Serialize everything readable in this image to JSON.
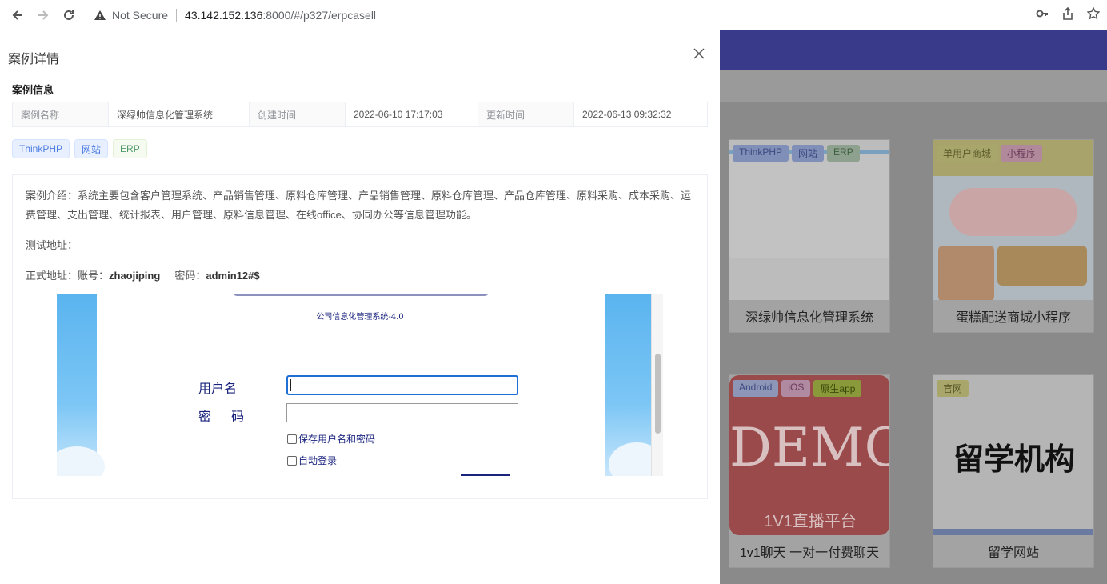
{
  "browser": {
    "not_secure": "Not Secure",
    "url_host": "43.142.152.136",
    "url_rest": ":8000/#/p327/erpcasell"
  },
  "drawer": {
    "title": "案例详情",
    "section_title": "案例信息",
    "info": {
      "name_label": "案例名称",
      "name_value": "深绿帅信息化管理系统",
      "created_label": "创建时间",
      "created_value": "2022-06-10 17:17:03",
      "updated_label": "更新时间",
      "updated_value": "2022-06-13 09:32:32"
    },
    "tags": [
      {
        "label": "ThinkPHP"
      },
      {
        "label": "网站"
      },
      {
        "label": "ERP"
      }
    ],
    "intro": "案例介绍：系统主要包含客户管理系统、产品销售管理、原料仓库管理、产品销售管理、原料仓库管理、产品仓库管理、原料采购、成本采购、运费管理、支出管理、统计报表、用户管理、原料信息管理、在线office、协同办公等信息管理功能。",
    "test_addr_label": "测试地址：",
    "prod_addr_label": "正式地址：账号：",
    "prod_account": "zhaojiping",
    "prod_pwd_label": "密码：",
    "prod_pwd": "admin12#$",
    "embed": {
      "subtitle": "公司信息化管理系统-4.0",
      "user_label": "用户名",
      "pwd_label": "密 码",
      "save_label": "保存用户名和密码",
      "auto_label": "自动登录"
    }
  },
  "background": {
    "cards": [
      {
        "title": "深绿帅信息化管理系统",
        "tags": [
          "ThinkPHP",
          "网站",
          "ERP"
        ]
      },
      {
        "title": "蛋糕配送商城小程序",
        "tags": [
          "单用户商城",
          "小程序"
        ]
      },
      {
        "title": "1v1聊天 一对一付费聊天",
        "tags": [
          "Android",
          "iOS",
          "原生app"
        ],
        "thumb_text": "DEMO",
        "thumb_sub": "1V1直播平台"
      },
      {
        "title": "留学网站",
        "tags": [
          "官网"
        ],
        "thumb_text": "留学机构"
      }
    ]
  }
}
